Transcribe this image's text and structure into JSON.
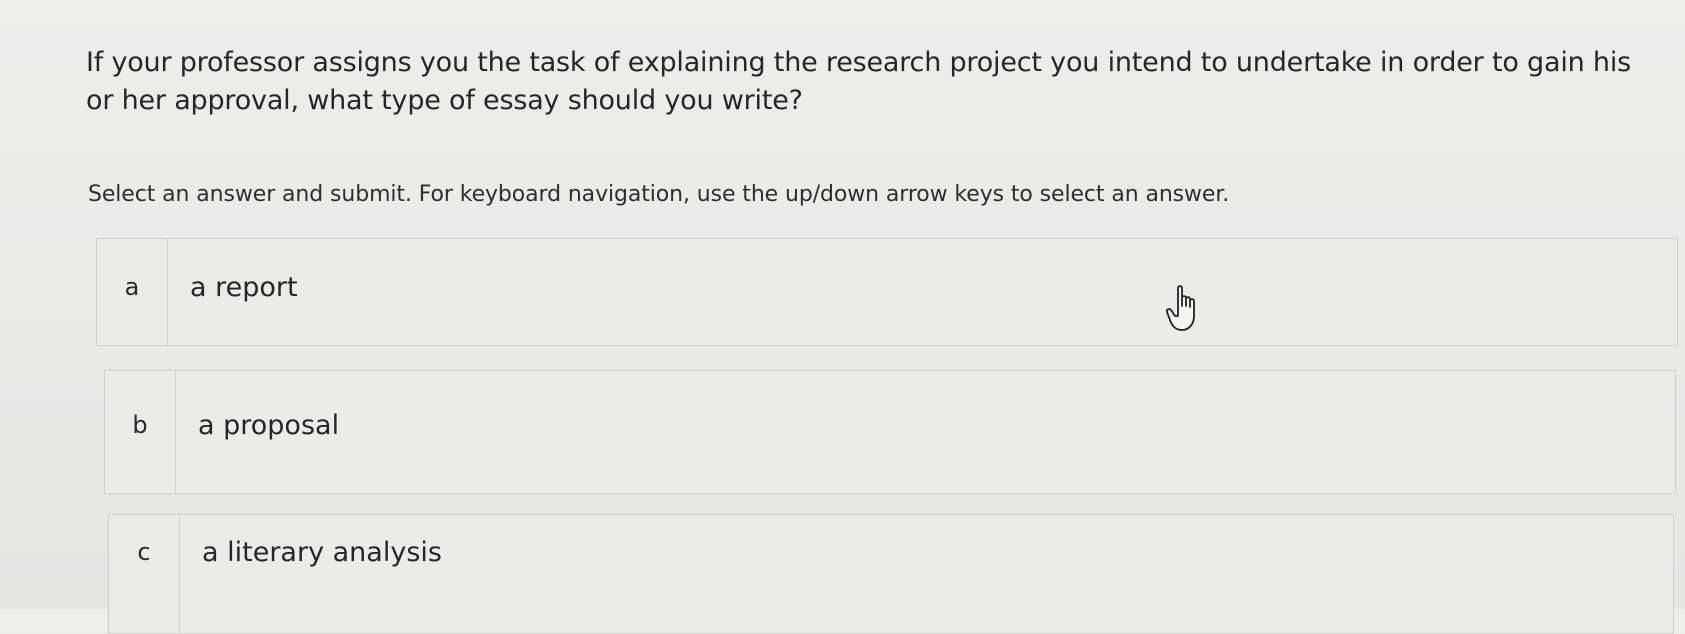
{
  "question": {
    "text": "If your professor assigns you the task of explaining the research project you intend to undertake in order to gain his or her approval, what type of essay should you write?"
  },
  "instructions": {
    "text": "Select an answer and submit. For keyboard navigation, use the up/down arrow keys to select an answer."
  },
  "options": [
    {
      "letter": "a",
      "label": "a report"
    },
    {
      "letter": "b",
      "label": "a proposal"
    },
    {
      "letter": "c",
      "label": "a literary analysis"
    }
  ],
  "cursor": {
    "icon": "hand-pointer-icon"
  },
  "colors": {
    "background": "#ebebea",
    "border": "#cfcfce",
    "text": "#262626"
  }
}
